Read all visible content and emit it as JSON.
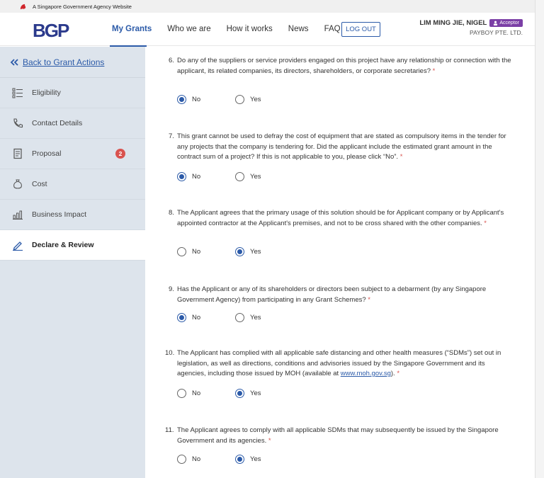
{
  "gov_bar": {
    "text": "A Singapore Government Agency Website"
  },
  "header": {
    "logo": "BGP",
    "nav": [
      "My Grants",
      "Who we are",
      "How it works",
      "News",
      "FAQ"
    ],
    "logout": "LOG OUT",
    "user_name": "LIM MING JIE, NIGEL",
    "role_badge": "Acceptor",
    "company": "PAYBOY PTE. LTD."
  },
  "sidebar": {
    "back": "Back to Grant Actions",
    "items": [
      {
        "label": "Eligibility",
        "icon": "checklist-icon"
      },
      {
        "label": "Contact Details",
        "icon": "phone-icon"
      },
      {
        "label": "Proposal",
        "icon": "document-icon",
        "count": "2"
      },
      {
        "label": "Cost",
        "icon": "money-bag-icon"
      },
      {
        "label": "Business Impact",
        "icon": "bar-chart-icon"
      },
      {
        "label": "Declare & Review",
        "icon": "pen-icon",
        "active": true
      }
    ]
  },
  "questions": [
    {
      "num": "6.",
      "text": "Do any of the suppliers or service providers engaged on this project have any relationship or connection with the applicant, its related companies, its directors, shareholders, or corporate secretaries?",
      "no": "No",
      "yes": "Yes",
      "selected": "No"
    },
    {
      "num": "7.",
      "text": "This grant cannot be used to defray the cost of equipment that are stated as compulsory items in the tender for any projects that the company is tendering for. Did the applicant include the estimated grant amount in the contract sum of a project? If this is not applicable to you, please click “No”.",
      "no": "No",
      "yes": "Yes",
      "selected": "No"
    },
    {
      "num": "8.",
      "text": "The Applicant agrees that the primary usage of this solution should be for Applicant company or by Applicant's appointed contractor at the Applicant's premises, and not to be cross shared with the other companies.",
      "no": "No",
      "yes": "Yes",
      "selected": "Yes"
    },
    {
      "num": "9.",
      "text": "Has the Applicant or any of its shareholders or directors been subject to a debarment (by any Singapore Government Agency) from participating in any Grant Schemes?",
      "no": "No",
      "yes": "Yes",
      "selected": "No"
    },
    {
      "num": "10.",
      "text_before": "The Applicant has complied with all applicable safe distancing and other health measures (“SDMs”) set out in legislation, as well as directions, conditions and advisories issued by the Singapore Government and its agencies, including those issued by MOH (available at ",
      "link": "www.moh.gov.sg",
      "text_after": ").",
      "no": "No",
      "yes": "Yes",
      "selected": "Yes"
    },
    {
      "num": "11.",
      "text": "The Applicant agrees to comply with all applicable SDMs that may subsequently be issued by the Singapore Government and its agencies.",
      "no": "No",
      "yes": "Yes",
      "selected": "Yes"
    }
  ],
  "required_mark": "*",
  "colors": {
    "primary": "#2b5aa8",
    "sidebar_bg": "#dde4ec",
    "badge": "#7b3fa6",
    "required": "#d9534f"
  }
}
